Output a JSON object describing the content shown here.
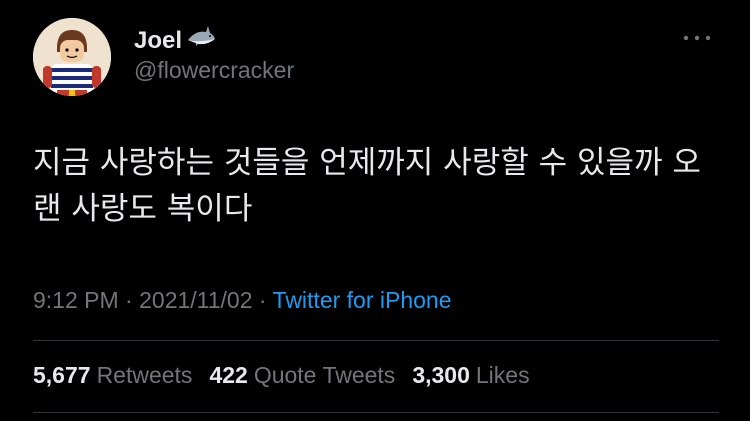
{
  "user": {
    "display_name": "Joel",
    "handle": "@flowercracker",
    "name_emoji": "shark-icon"
  },
  "tweet": {
    "text": "지금 사랑하는 것들을 언제까지 사랑할 수 있을까 오랜 사랑도 복이다",
    "time": "9:12 PM",
    "separator": " · ",
    "date": "2021/11/02",
    "source": "Twitter for iPhone"
  },
  "stats": {
    "retweets_count": "5,677",
    "retweets_label": "Retweets",
    "quote_count": "422",
    "quote_label": "Quote Tweets",
    "likes_count": "3,300",
    "likes_label": "Likes"
  },
  "colors": {
    "background": "#000000",
    "text": "#e7e9ea",
    "secondary": "#71767b",
    "link": "#1d9bf0"
  }
}
